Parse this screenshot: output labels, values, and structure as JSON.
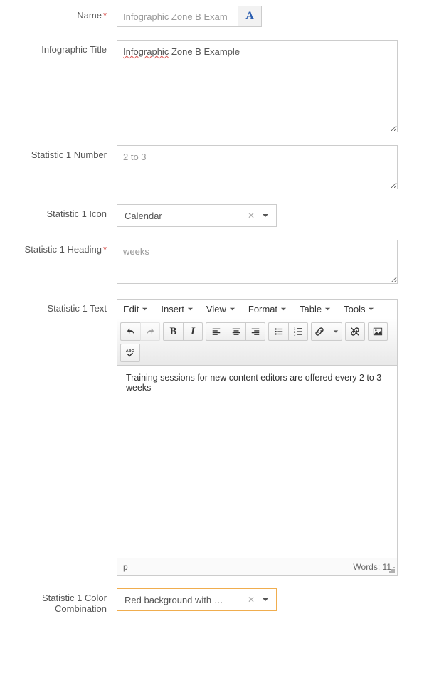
{
  "labels": {
    "name": "Name",
    "infographic_title": "Infographic Title",
    "stat1_number": "Statistic 1 Number",
    "stat1_icon": "Statistic 1 Icon",
    "stat1_heading": "Statistic 1 Heading",
    "stat1_text": "Statistic 1 Text",
    "stat1_color": "Statistic 1 Color Combination"
  },
  "values": {
    "name": "Infographic Zone B Exam",
    "title_part1": "Infographic",
    "title_part2": " Zone B Example",
    "stat1_number": "2 to 3",
    "stat1_icon": "Calendar",
    "stat1_heading": "weeks",
    "stat1_text_body": "Training sessions for new content editors are offered every 2 to 3 weeks",
    "stat1_color": "Red background with …"
  },
  "editor": {
    "menu": {
      "edit": "Edit",
      "insert": "Insert",
      "view": "View",
      "format": "Format",
      "table": "Table",
      "tools": "Tools"
    },
    "status_path": "p",
    "status_words_label": "Words: ",
    "status_words_value": "11"
  }
}
